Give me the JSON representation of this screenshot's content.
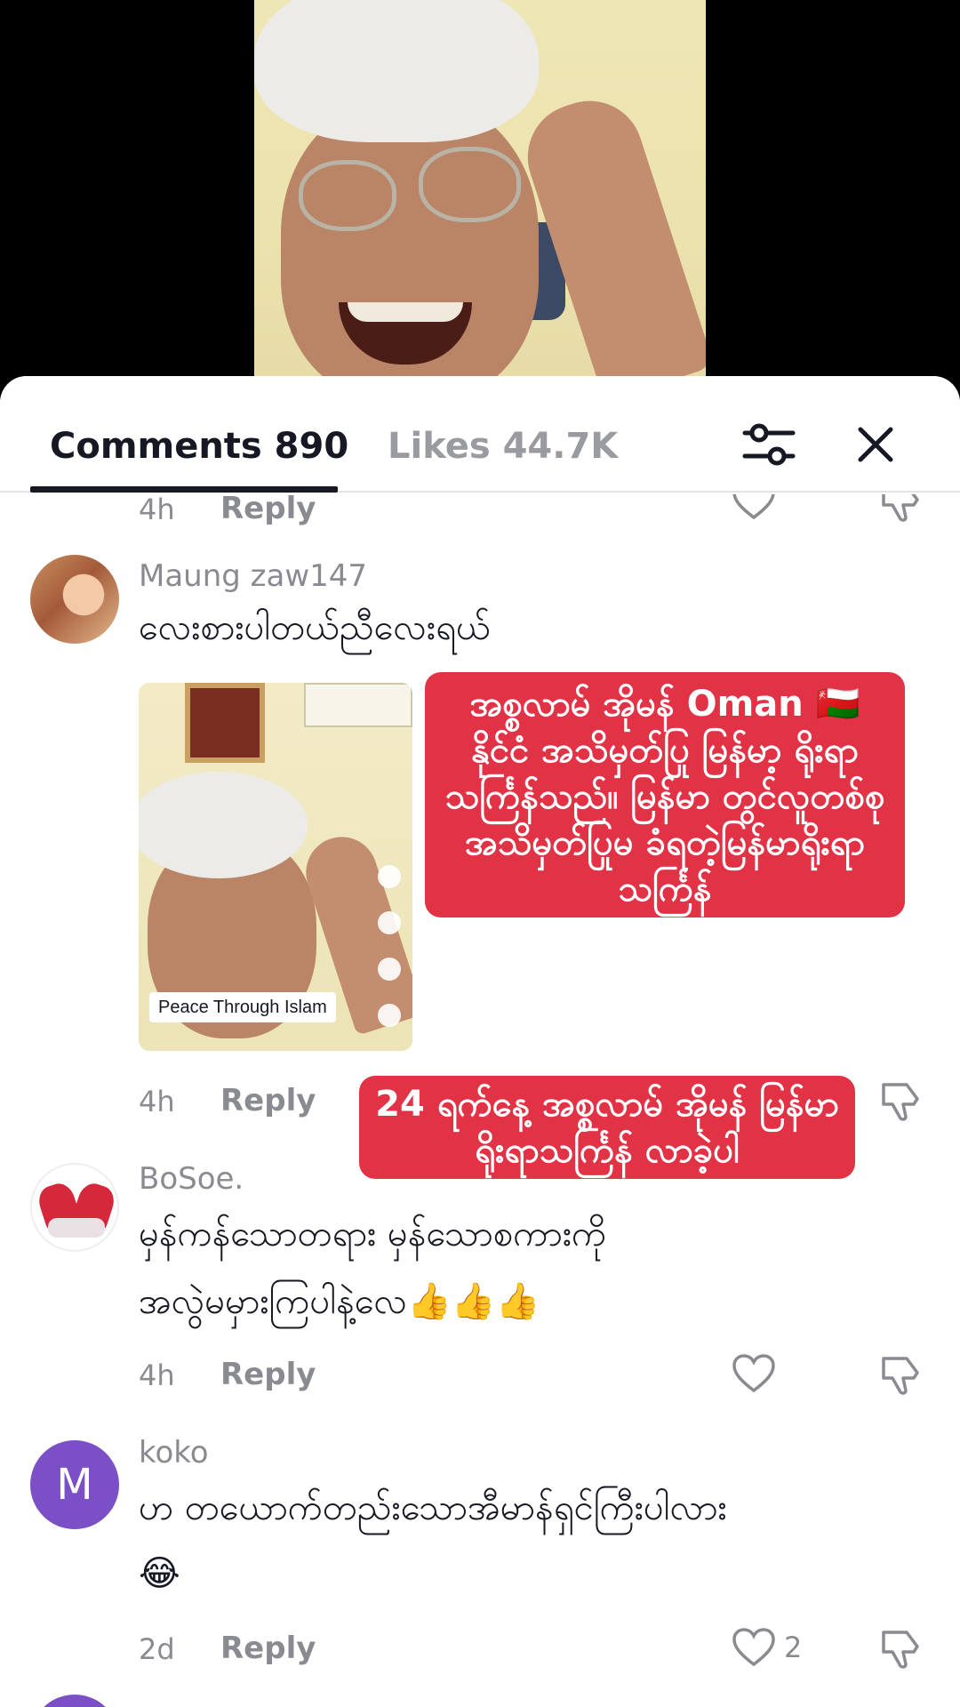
{
  "header": {
    "comments_tab": "Comments 890",
    "likes_tab": "Likes 44.7K"
  },
  "partial_row": {
    "time": "4h",
    "reply": "Reply"
  },
  "comments": [
    {
      "username": "Maung zaw147",
      "text": "လေးစားပါတယ်ညီလေးရယ်",
      "thumbnail_caption": "Peace Through Islam",
      "time": "4h",
      "reply": "Reply"
    },
    {
      "username": "BoSoe.",
      "text_line1": "မှန်ကန်သောတရား မှန်သောစကားကို",
      "text_line2": "အလွဲမမှားကြပါနဲ့လေ👍👍👍",
      "time": "4h",
      "reply": "Reply"
    },
    {
      "username": "koko",
      "avatar_initial": "M",
      "text_line1": "ဟ တယောက်တည်းသောအီမာန်ရှင်ကြီးပါလား",
      "text_line2": "😂",
      "time": "2d",
      "reply": "Reply",
      "likes": "2"
    }
  ],
  "overlay_captions": {
    "caption1": "အစ္စလာမ် အိုမန် Oman 🇴🇲 နိုင်ငံ အသိမှတ်ပြု မြန်မာ့ ရိုးရာသင်္ကြန်သည်။ မြန်မာ တွင်လူတစ်စုအသိမှတ်ပြုမ ခံရတဲ့မြန်မာရိုးရာသင်္ကြန်",
    "caption2": "24 ရက်နေ့ အစ္စလာမ် အိုမန် မြန်မာရိုးရာသင်္ကြန် လာခဲ့ပါ"
  },
  "colors": {
    "accent_red": "#e23245",
    "muted_text": "#8a8b91",
    "avatar_purple": "#7b4fc5"
  }
}
